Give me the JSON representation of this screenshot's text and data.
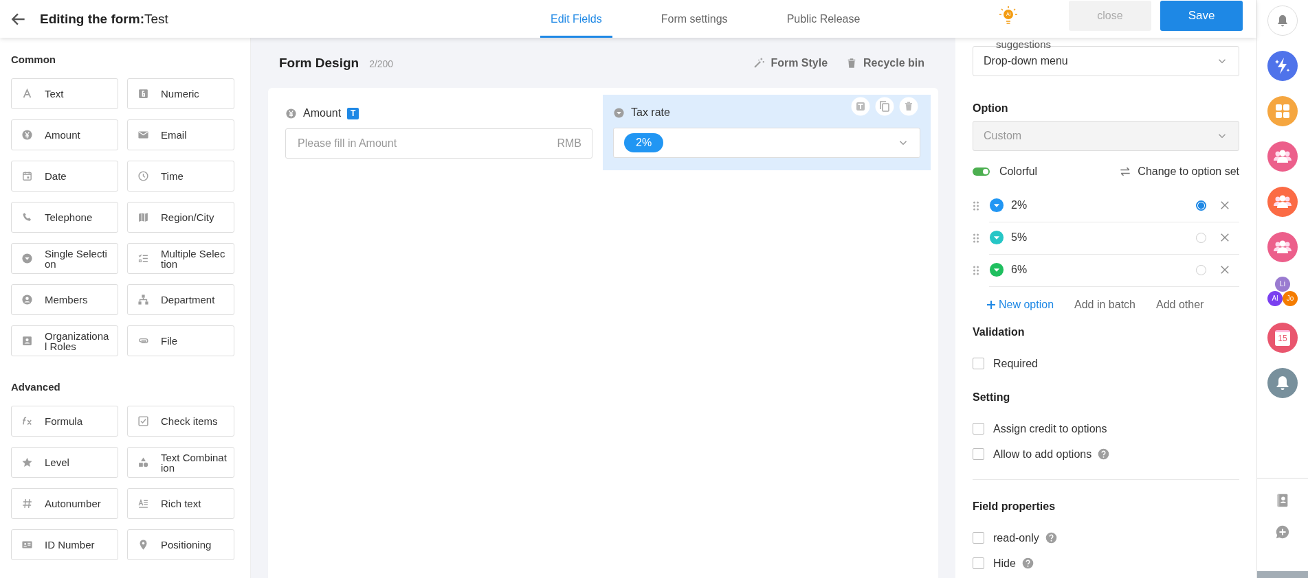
{
  "header": {
    "title_label": "Editing the form:",
    "title_name": "Test",
    "tabs": [
      {
        "label": "Edit Fields",
        "selected": true
      },
      {
        "label": "Form settings",
        "selected": false
      },
      {
        "label": "Public Release",
        "selected": false
      }
    ],
    "ai_badge": "AI",
    "close_button": "close",
    "save_button": "Save"
  },
  "field_palette": [
    {
      "title": "Common",
      "items": [
        "Text",
        "Numeric",
        "Amount",
        "Email",
        "Date",
        "Time",
        "Telephone",
        "Region/City",
        "Single Selection",
        "Multiple Selection",
        "Members",
        "Department",
        "Organizational Roles",
        "File"
      ]
    },
    {
      "title": "Advanced",
      "items": [
        "Formula",
        "Check items",
        "Level",
        "Text Combination",
        "Autonumber",
        "Rich text",
        "ID Number",
        "Positioning"
      ]
    }
  ],
  "canvas": {
    "title": "Form Design",
    "count": "2/200",
    "actions": [
      "Form Style",
      "Recycle bin"
    ],
    "fields": [
      {
        "kind": "amount",
        "label": "Amount",
        "badge": "T",
        "placeholder": "Please fill in Amount",
        "unit": "RMB",
        "selected": false
      },
      {
        "kind": "select",
        "label": "Tax rate",
        "value": "2%",
        "selected": true
      }
    ]
  },
  "properties": {
    "suggestions": "suggestions",
    "display_type": "Drop-down menu",
    "option_title": "Option",
    "option_source": {
      "value": "Custom",
      "disabled": true
    },
    "colorful": {
      "label": "Colorful",
      "on": true
    },
    "change_link": "Change to option set",
    "options": [
      {
        "label": "2%",
        "color": "#2196f3",
        "selected": true
      },
      {
        "label": "5%",
        "color": "#26c6c6",
        "selected": false
      },
      {
        "label": "6%",
        "color": "#1fbf5f",
        "selected": false
      }
    ],
    "option_actions": [
      "New option",
      "Add in batch",
      "Add other"
    ],
    "sections": [
      {
        "title": "Validation",
        "checks": [
          {
            "label": "Required",
            "checked": false
          }
        ]
      },
      {
        "title": "Setting",
        "checks": [
          {
            "label": "Assign credit to options",
            "checked": false
          },
          {
            "label": "Allow to add options",
            "checked": false,
            "help": true
          }
        ]
      },
      {
        "title": "Field properties",
        "divider": true,
        "checks": [
          {
            "label": "read-only",
            "checked": false,
            "help": true
          },
          {
            "label": "Hide",
            "checked": false,
            "help": true
          }
        ]
      }
    ]
  },
  "sidebar": {
    "apps": [
      {
        "kind": "bell-outline"
      },
      {
        "kind": "bolt",
        "color": "#4f73ea"
      },
      {
        "kind": "grid",
        "color": "#f5a640"
      },
      {
        "kind": "people",
        "color": "#ec5f8b"
      },
      {
        "kind": "people",
        "color": "#fb6b45"
      },
      {
        "kind": "people",
        "color": "#ec5f8b"
      },
      {
        "kind": "avatars",
        "avatars": [
          {
            "initials": "Li",
            "color": "#9a7bd0"
          },
          {
            "initials": "Al",
            "color": "#7a3ff0"
          },
          {
            "initials": "Jo",
            "color": "#f57c00"
          }
        ]
      },
      {
        "kind": "calendar",
        "color": "#e9566e",
        "day": "15"
      },
      {
        "kind": "bell",
        "color": "#78909c"
      }
    ]
  }
}
